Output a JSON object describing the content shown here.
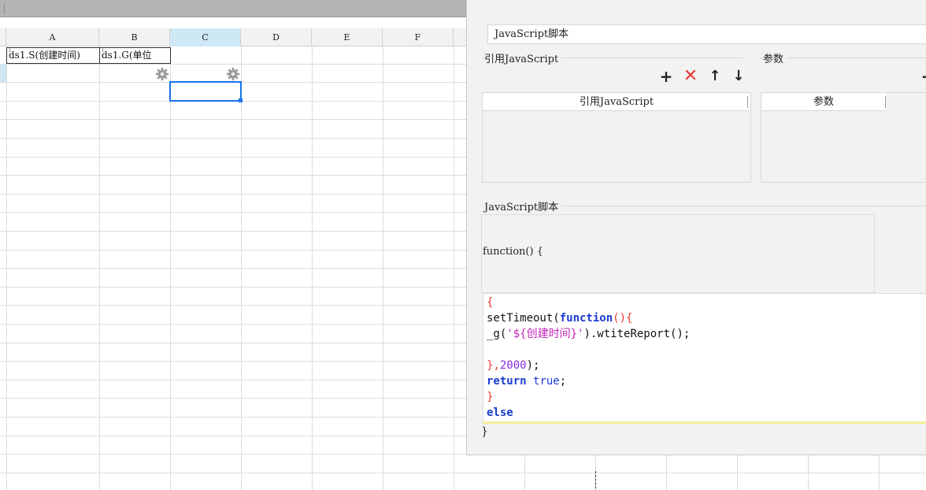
{
  "sheet": {
    "columns": [
      "A",
      "B",
      "C",
      "D",
      "E",
      "F"
    ],
    "cells": {
      "a1": "ds1.S(创建时间)",
      "b1": "ds1.G(单位"
    }
  },
  "dialog": {
    "script_field": "JavaScript脚本",
    "ref_group_label": "引用JavaScript",
    "ref_table_header": "引用JavaScript",
    "param_group_label": "参数",
    "param_table_header": "参数",
    "toolbar": {
      "add": "+",
      "delete": "✕",
      "up": "↑",
      "down": "↓"
    },
    "script_group_label": "JavaScript脚本",
    "function_header": "function() {",
    "code": {
      "l1": "{",
      "l2_a": "setTimeout(",
      "l2_b": "function",
      "l2_c": "(){",
      "l3_a": "_g(",
      "l3_b": "'${创建时间}'",
      "l3_c": ").wtiteReport();",
      "l5_a": "},",
      "l5_b": "2000",
      "l5_c": ");",
      "l6_a": "return",
      "l6_b": "true",
      "l6_c": ";",
      "l7": "}",
      "l8": "else"
    },
    "function_footer": "}"
  },
  "colors": {
    "selection": "#1a73e8",
    "selected_header": "#cfe8f5",
    "delete_icon": "#e53935",
    "keyword": "#1a3ccf"
  }
}
